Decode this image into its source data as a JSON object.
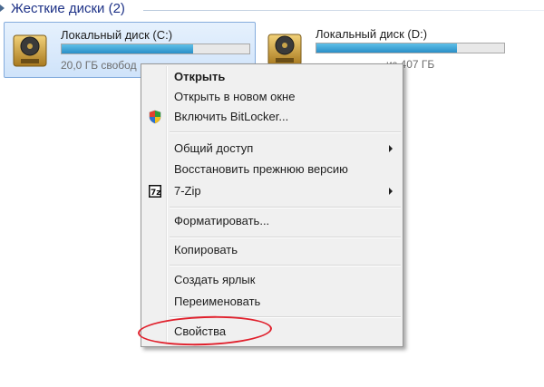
{
  "group": {
    "title": "Жесткие диски (2)"
  },
  "drives": [
    {
      "name": "Локальный диск (C:)",
      "info": "20,0 ГБ свобод",
      "fill": 0.7
    },
    {
      "name": "Локальный диск (D:)",
      "info": "из 407 ГБ",
      "fill": 0.75
    }
  ],
  "menu": {
    "items": [
      {
        "label": "Открыть",
        "bold": true
      },
      {
        "label": "Открыть в новом окне"
      },
      {
        "label": "Включить BitLocker...",
        "icon": "shield-icon"
      },
      {
        "label": "Общий доступ",
        "submenu": true
      },
      {
        "label": "Восстановить прежнюю версию"
      },
      {
        "label": "7-Zip",
        "icon": "7zip-icon",
        "submenu": true
      },
      {
        "label": "Форматировать..."
      },
      {
        "label": "Копировать"
      },
      {
        "label": "Создать ярлык"
      },
      {
        "label": "Переименовать"
      },
      {
        "label": "Свойства"
      }
    ]
  },
  "colors": {
    "accent_highlight": "#e0202c",
    "header_text": "#1e3287",
    "bar_fill": "#2a8fc7"
  }
}
